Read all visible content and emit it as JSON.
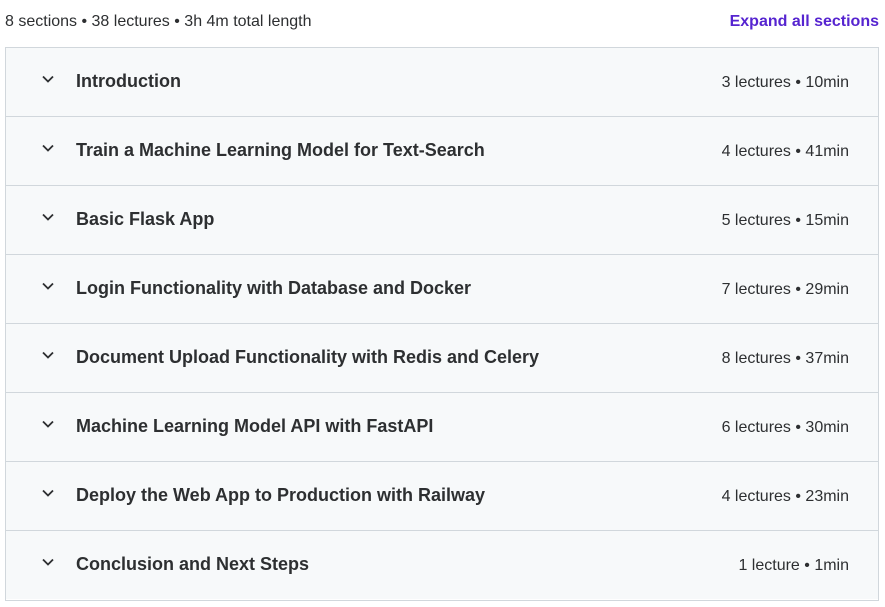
{
  "header": {
    "summary": "8 sections • 38 lectures • 3h 4m total length",
    "expand_label": "Expand all sections"
  },
  "icons": {
    "chevron": "chevron-down-icon"
  },
  "colors": {
    "accent": "#5624d0",
    "section_bg": "#f7f9fa",
    "border": "#d1d7dc",
    "text": "#2d2f31"
  },
  "sections": [
    {
      "title": "Introduction",
      "meta": "3 lectures • 10min"
    },
    {
      "title": "Train a Machine Learning Model for Text-Search",
      "meta": "4 lectures • 41min"
    },
    {
      "title": "Basic Flask App",
      "meta": "5 lectures • 15min"
    },
    {
      "title": "Login Functionality with Database and Docker",
      "meta": "7 lectures • 29min"
    },
    {
      "title": "Document Upload Functionality with Redis and Celery",
      "meta": "8 lectures • 37min"
    },
    {
      "title": "Machine Learning Model API with FastAPI",
      "meta": "6 lectures • 30min"
    },
    {
      "title": "Deploy the Web App to Production with Railway",
      "meta": "4 lectures • 23min"
    },
    {
      "title": "Conclusion and Next Steps",
      "meta": "1 lecture • 1min"
    }
  ]
}
